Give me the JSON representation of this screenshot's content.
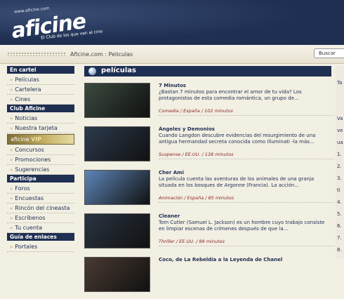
{
  "header": {
    "url": "www.aficine.com",
    "logo": "aficine",
    "tagline": "El Club de los que van al cine"
  },
  "breadcrumb": "Aficine.com : Peliculas",
  "search": {
    "label": "Buscar"
  },
  "sidebar": {
    "sections": [
      {
        "title": "En cartel",
        "items": [
          "Películas",
          "Cartelera",
          "Cines"
        ]
      },
      {
        "title": "Club Aficine",
        "items": [
          "Noticias",
          "Nuestra tarjeta"
        ],
        "vip": {
          "brand": "aficine",
          "tag": "VIP"
        },
        "items2": [
          "Concursos",
          "Promociones",
          "Sugerencias"
        ]
      },
      {
        "title": "Participa",
        "items": [
          "Foros",
          "Encuestas",
          "Rincón del cineasta",
          "Escríbenos",
          "Tu cuenta"
        ]
      },
      {
        "title": "Guía de enlaces",
        "items": [
          "Portales"
        ]
      }
    ]
  },
  "main": {
    "title": "películas",
    "films": [
      {
        "title": "7 Minutos",
        "desc": "¿Bastan 7 minutos para encontrar el amor de tu vida? Los protagonistas de esta comedia romántica, un grupo de...",
        "meta": "Comedia / España / 102 minutos",
        "thumb_color": "#3b4a3f"
      },
      {
        "title": "Ángeles y Demonios",
        "desc": "Cuando Langdon descubre evidencias del resurgimiento de una antigua hermandad secreta conocida como Illuminati -la más...",
        "meta": "Suspense / EE.UU. / 138 minutos",
        "thumb_color": "#2c3a4d"
      },
      {
        "title": "Cher Ami",
        "desc": "La película cuenta las aventuras de los animales de una granja situada en los bosques de Argonne (Francia). La acción...",
        "meta": "Animación / España / 85 minutos",
        "thumb_color": "#5d86b8"
      },
      {
        "title": "Cleaner",
        "desc": "Tom Cutler (Samuel L. Jackson) es un hombre cuyo trabajo consiste en limpiar escenas de crímenes después de que la...",
        "meta": "Thriller / EE.UU. / 89 minutos",
        "thumb_color": "#2a3442"
      },
      {
        "title": "Coco, de La Rebeldía a la Leyenda de Chanel",
        "desc": "",
        "meta": "",
        "thumb_color": "#4a3a32"
      }
    ]
  },
  "right": {
    "lines": [
      "Ta",
      "",
      "",
      "Va",
      "ve",
      "ua",
      "1.",
      "2.",
      "3.",
      "ti",
      "4.",
      "5.",
      "6.",
      "7.",
      "8."
    ]
  }
}
